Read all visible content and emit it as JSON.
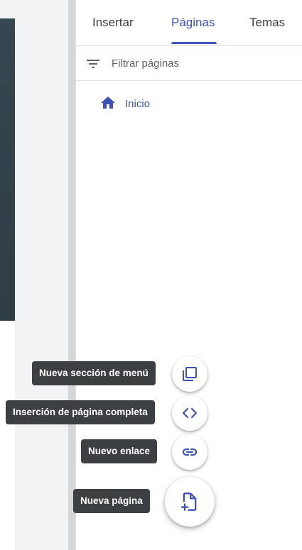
{
  "tabs": {
    "insert": "Insertar",
    "pages": "Páginas",
    "themes": "Temas"
  },
  "filter": {
    "placeholder": "Filtrar páginas"
  },
  "pages": [
    {
      "label": "Inicio",
      "icon": "home-icon"
    }
  ],
  "speed_dial": {
    "menu_section": {
      "label": "Nueva sección de menú",
      "icon": "copy-page-icon"
    },
    "full_page_embed": {
      "label": "Inserción de página completa",
      "icon": "code-icon"
    },
    "new_link": {
      "label": "Nuevo enlace",
      "icon": "link-icon"
    },
    "new_page": {
      "label": "Nueva página",
      "icon": "add-page-icon"
    }
  },
  "colors": {
    "accent": "#3f51b5",
    "tooltip_bg": "#3c4043",
    "header_image": "#36474f"
  }
}
